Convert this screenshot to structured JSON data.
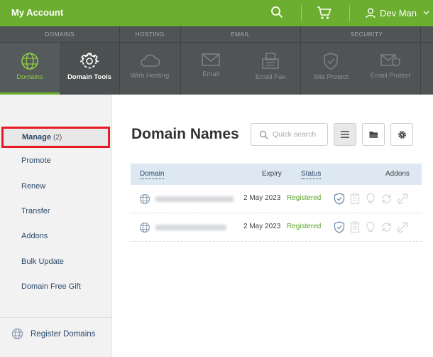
{
  "header": {
    "title": "My Account",
    "user_name": "Dev Man",
    "brand_color": "#6cae2f"
  },
  "categories": [
    {
      "label": "DOMAINS"
    },
    {
      "label": "HOSTING"
    },
    {
      "label": "EMAIL"
    },
    {
      "label": "SECURITY"
    }
  ],
  "products": [
    {
      "label": "Domains",
      "icon": "globe-icon",
      "active": true
    },
    {
      "label": "Domain Tools",
      "icon": "gear-icon"
    },
    {
      "label": "Web Hosting",
      "icon": "cloud-icon"
    },
    {
      "label": "Email",
      "icon": "envelope-icon"
    },
    {
      "label": "Email Fax",
      "icon": "fax-icon"
    },
    {
      "label": "Site Protect",
      "icon": "shield-icon"
    },
    {
      "label": "Email Protect",
      "icon": "mail-shield-icon"
    }
  ],
  "sidebar": {
    "manage_label": "Manage",
    "manage_count": "(2)",
    "items": [
      {
        "label": "Promote"
      },
      {
        "label": "Renew"
      },
      {
        "label": "Transfer"
      },
      {
        "label": "Addons"
      },
      {
        "label": "Bulk Update"
      },
      {
        "label": "Domain Free Gift"
      }
    ],
    "register_label": "Register Domains"
  },
  "main": {
    "title": "Domain Names",
    "search_placeholder": "Quick search",
    "columns": {
      "domain": "Domain",
      "expiry": "Expiry",
      "status": "Status",
      "addons": "Addons"
    },
    "rows": [
      {
        "expiry": "2 May 2023",
        "status": "Registered"
      },
      {
        "expiry": "2 May 2023",
        "status": "Registered"
      }
    ]
  }
}
